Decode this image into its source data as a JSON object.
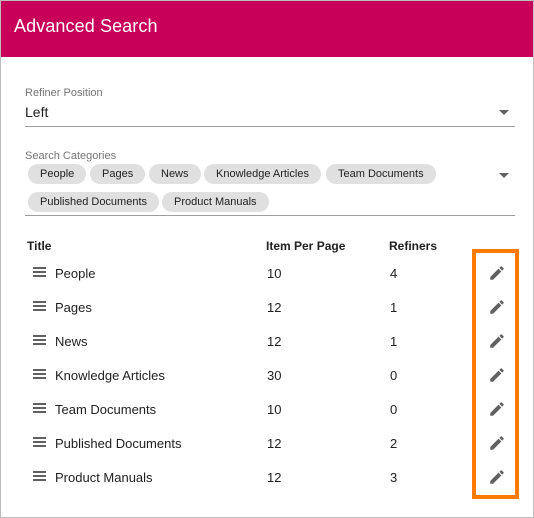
{
  "header": {
    "title": "Advanced Search"
  },
  "refiner_position": {
    "label": "Refiner Position",
    "value": "Left"
  },
  "search_categories": {
    "label": "Search Categories",
    "chips": [
      "People",
      "Pages",
      "News",
      "Knowledge Articles",
      "Team Documents",
      "Published Documents",
      "Product Manuals"
    ]
  },
  "table": {
    "headers": {
      "title": "Title",
      "items_per_page": "Item Per Page",
      "refiners": "Refiners"
    },
    "rows": [
      {
        "title": "People",
        "items": "10",
        "refiners": "4"
      },
      {
        "title": "Pages",
        "items": "12",
        "refiners": "1"
      },
      {
        "title": "News",
        "items": "12",
        "refiners": "1"
      },
      {
        "title": "Knowledge Articles",
        "items": "30",
        "refiners": "0"
      },
      {
        "title": "Team Documents",
        "items": "10",
        "refiners": "0"
      },
      {
        "title": "Published Documents",
        "items": "12",
        "refiners": "2"
      },
      {
        "title": "Product Manuals",
        "items": "12",
        "refiners": "3"
      }
    ]
  },
  "icons": {
    "row_handle": "drag-handle-icon",
    "row_action": "pencil-icon",
    "dropdown": "dropdown-caret-icon"
  },
  "colors": {
    "header_bg": "#c8005a",
    "highlight": "#ff7a00",
    "chip_bg": "#e0e0e0"
  }
}
